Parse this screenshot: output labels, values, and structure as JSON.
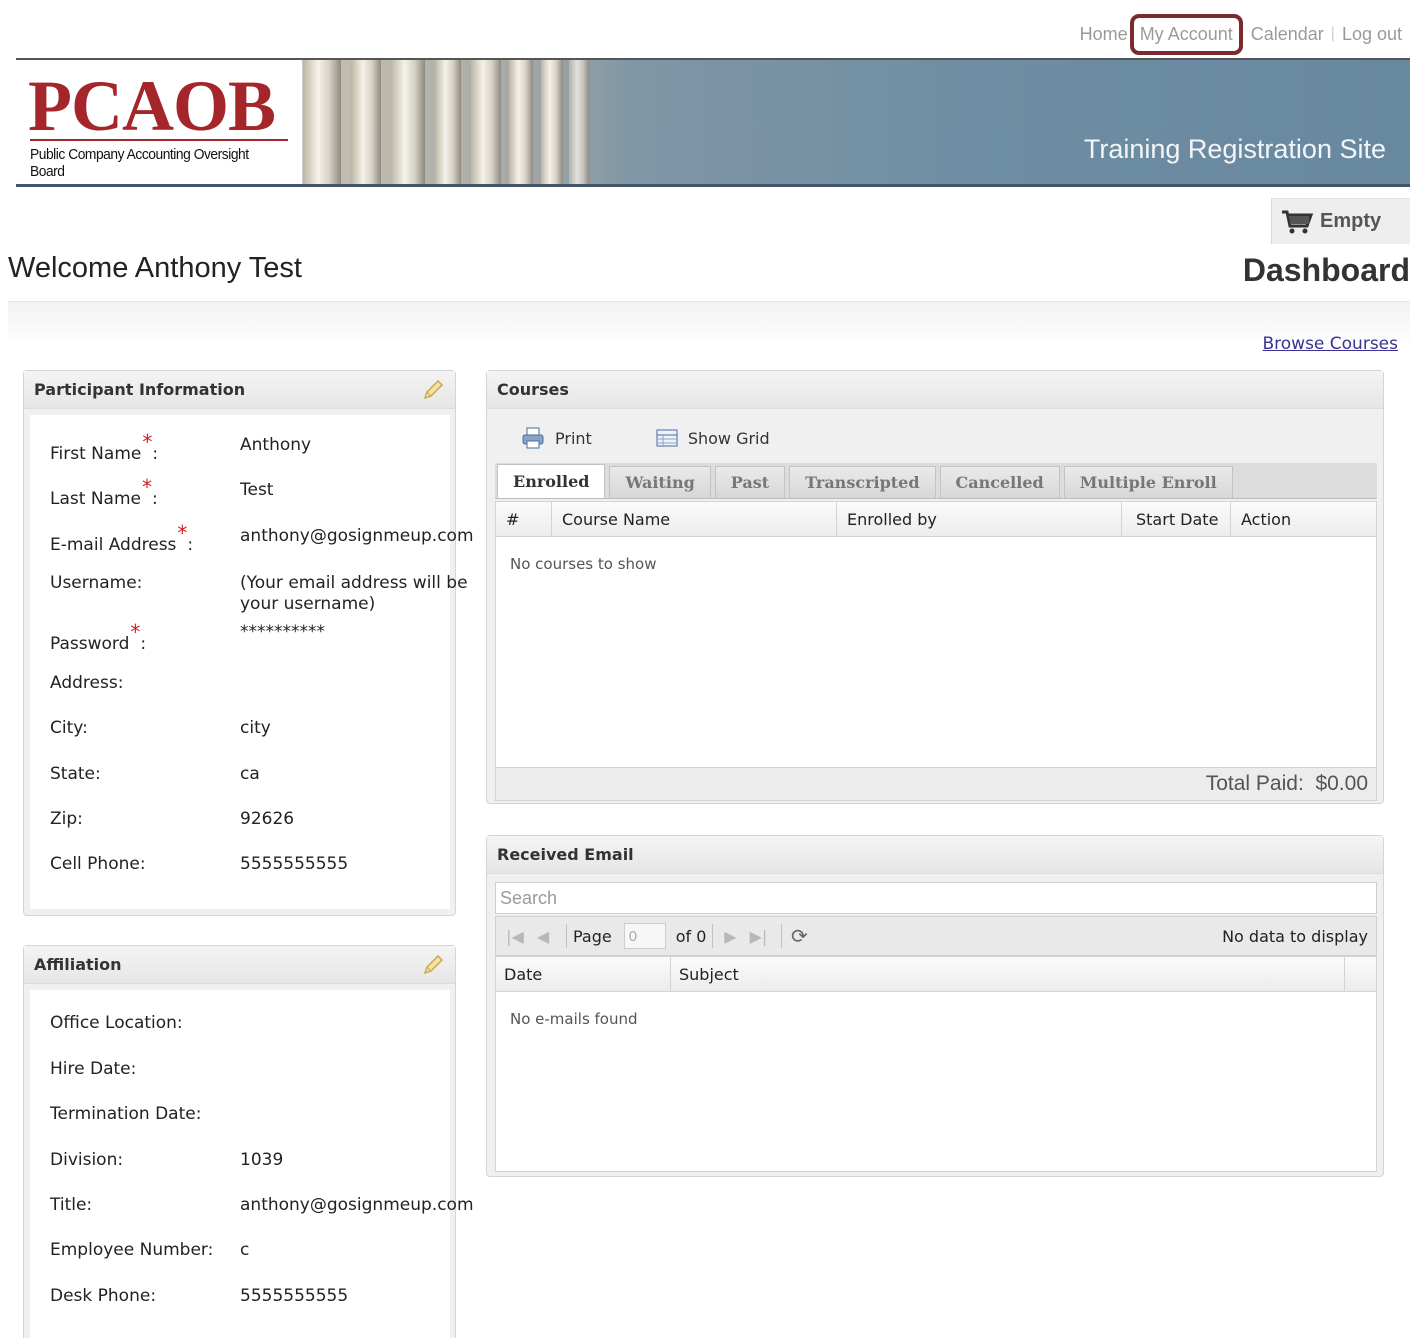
{
  "nav": {
    "home": "Home",
    "my_account": "My Account",
    "calendar": "Calendar",
    "logout": "Log out",
    "separator": "|"
  },
  "header": {
    "logo": "PCAOB",
    "logo_subtitle": "Public Company Accounting Oversight Board",
    "site_title": "Training Registration Site"
  },
  "cart": {
    "label": "Empty",
    "icon": "cart-icon"
  },
  "welcome": "Welcome Anthony Test",
  "page_title": "Dashboard",
  "browse_courses": "Browse Courses",
  "required_mark": "*",
  "participant": {
    "title": "Participant Information",
    "fields": [
      {
        "label": "First Name",
        "required": true,
        "value": "Anthony"
      },
      {
        "label": "Last Name",
        "required": true,
        "value": "Test"
      },
      {
        "label": "E-mail Address",
        "required": true,
        "value": "anthony@gosignmeup.com"
      },
      {
        "label": "Username:",
        "required": false,
        "value": "(Your email address will be your username)"
      },
      {
        "label": "Password",
        "required": true,
        "value": "**********"
      },
      {
        "label": "Address:",
        "required": false,
        "value": ""
      },
      {
        "label": "City:",
        "required": false,
        "value": "city"
      },
      {
        "label": "State:",
        "required": false,
        "value": "ca"
      },
      {
        "label": "Zip:",
        "required": false,
        "value": "92626"
      },
      {
        "label": "Cell Phone:",
        "required": false,
        "value": "5555555555"
      }
    ]
  },
  "affiliation": {
    "title": "Affiliation",
    "fields": [
      {
        "label": "Office Location:",
        "value": ""
      },
      {
        "label": "Hire Date:",
        "value": ""
      },
      {
        "label": "Termination Date:",
        "value": ""
      },
      {
        "label": "Division:",
        "value": "1039"
      },
      {
        "label": "Title:",
        "value": "anthony@gosignmeup.com"
      },
      {
        "label": "Employee Number:",
        "value": "c"
      },
      {
        "label": "Desk Phone:",
        "value": "5555555555"
      }
    ]
  },
  "courses": {
    "title": "Courses",
    "print": "Print",
    "show_grid": "Show Grid",
    "tabs": [
      "Enrolled",
      "Waiting",
      "Past",
      "Transcripted",
      "Cancelled",
      "Multiple Enroll"
    ],
    "active_tab": "Enrolled",
    "columns": [
      "#",
      "Course Name",
      "Enrolled by",
      "Start Date",
      "Action"
    ],
    "empty": "No courses to show",
    "total_paid": "Total Paid:  $0.00"
  },
  "email": {
    "title": "Received Email",
    "search_placeholder": "Search",
    "page_label": "Page",
    "page_value": "0",
    "of_label": "of 0",
    "no_data": "No data to display",
    "columns": [
      "Date",
      "Subject"
    ],
    "empty": "No e-mails found"
  },
  "colors": {
    "brand_red": "#a4252a",
    "highlight_border": "#7b2a2e",
    "link": "#3b3096"
  }
}
